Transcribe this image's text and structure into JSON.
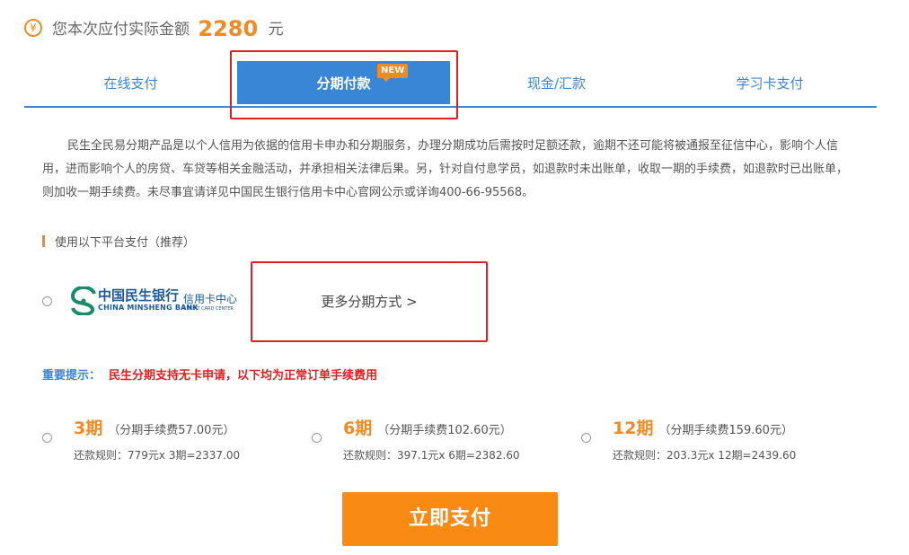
{
  "header": {
    "icon": "yen-icon",
    "prefix": "您本次应付实际金额",
    "amount": "2280",
    "unit": "元"
  },
  "tabs": [
    {
      "label": "在线支付",
      "active": false
    },
    {
      "label": "分期付款",
      "active": true
    },
    {
      "label": "现金/汇款",
      "active": false
    },
    {
      "label": "学习卡支付",
      "active": false
    }
  ],
  "new_badge": "NEW",
  "description": "民生全民易分期产品是以个人信用为依据的信用卡申办和分期服务，办理分期成功后需按时足额还款，逾期不还可能将被通报至征信中心，影响个人信用，进而影响个人的房贷、车贷等相关金融活动，并承担相关法律后果。另，针对自付息学员，如退款时未出账单，收取一期的手续费，如退款时已出账单，则加收一期手续费。未尽事宜请详见中国民生银行信用卡中心官网公示或详询400-66-95568。",
  "section_label": "使用以下平台支付（推荐）",
  "bank": {
    "name_cn": "中国民生银行",
    "name_en": "CHINA MINSHENG BANK",
    "card_center": "信用卡中心",
    "card_center_small": "CREDIT CARD CENTER"
  },
  "more_methods": "更多分期方式 >",
  "notice": {
    "label": "重要提示：",
    "text": "民生分期支持无卡申请，以下均为正常订单手续费用"
  },
  "plans": [
    {
      "period": "3期",
      "fee": "（分期手续费57.00元）",
      "rule": "还款规则：779元x 3期=2337.00"
    },
    {
      "period": "6期",
      "fee": "（分期手续费102.60元）",
      "rule": "还款规则：397.1元x 6期=2382.60"
    },
    {
      "period": "12期",
      "fee": "（分期手续费159.60元）",
      "rule": "还款规则：203.3元x 12期=2439.60"
    }
  ],
  "pay_button": "立即支付",
  "colors": {
    "accent_blue": "#3a86d6",
    "accent_orange": "#f08a25",
    "alert_red": "#e02020",
    "button_orange": "#f98a14"
  }
}
